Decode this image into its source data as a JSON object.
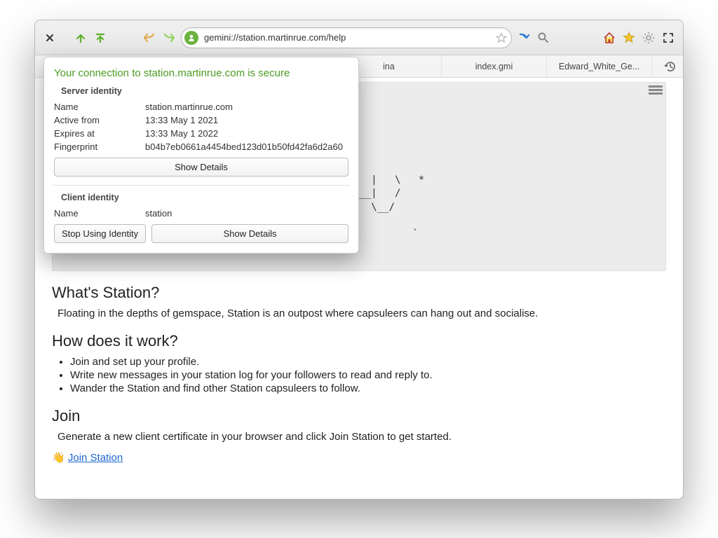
{
  "toolbar": {
    "url": "gemini://station.martinrue.com/help"
  },
  "tabs": [
    {
      "label": "ina"
    },
    {
      "label": "index.gmi"
    },
    {
      "label": "Edward_White_Ge..."
    }
  ],
  "popover": {
    "title": "Your connection to station.martinrue.com is secure",
    "server": {
      "heading": "Server identity",
      "name_k": "Name",
      "name_v": "station.martinrue.com",
      "active_k": "Active from",
      "active_v": "13:33 May  1 2021",
      "expires_k": "Expires at",
      "expires_v": "13:33 May  1 2022",
      "fp_k": "Fingerprint",
      "fp_v": "b04b7eb0661a4454bed123d01b50fd42fa6d2a60",
      "details_btn": "Show Details"
    },
    "client": {
      "heading": "Client identity",
      "name_k": "Name",
      "name_v": "station",
      "stop_btn": "Stop Using Identity",
      "details_btn": "Show Details"
    }
  },
  "page": {
    "ascii": "                                 *\n              _______ __       __  _\n             / _____// /_ ____/ /_(_)____.,.___\n             \\____ \\/ __// __ / __/ // __ \\  \\  \\\n            _____/ / /_./ /_// /_/ // /_/ ( <_> )   |   \\   *\n           /______/\\__/ \\__,\\\\__/__/\\____/ \\___/|___|   /\n                                           \\/       \\__/\n– a place for capsuleers to hang out –\n                     .                                     `",
    "h_what": "What's Station?",
    "p_what": "Floating in the depths of gemspace, Station is an outpost where capsuleers can hang out and socialise.",
    "h_how": "How does it work?",
    "li1": "Join and set up your profile.",
    "li2": "Write new messages in your station log for your followers to read and reply to.",
    "li3": "Wander the Station and find other Station capsuleers to follow.",
    "h_join": "Join",
    "p_join": "Generate a new client certificate in your browser and click Join Station to get started.",
    "join_emoji": "👋",
    "join_link": "Join Station"
  }
}
